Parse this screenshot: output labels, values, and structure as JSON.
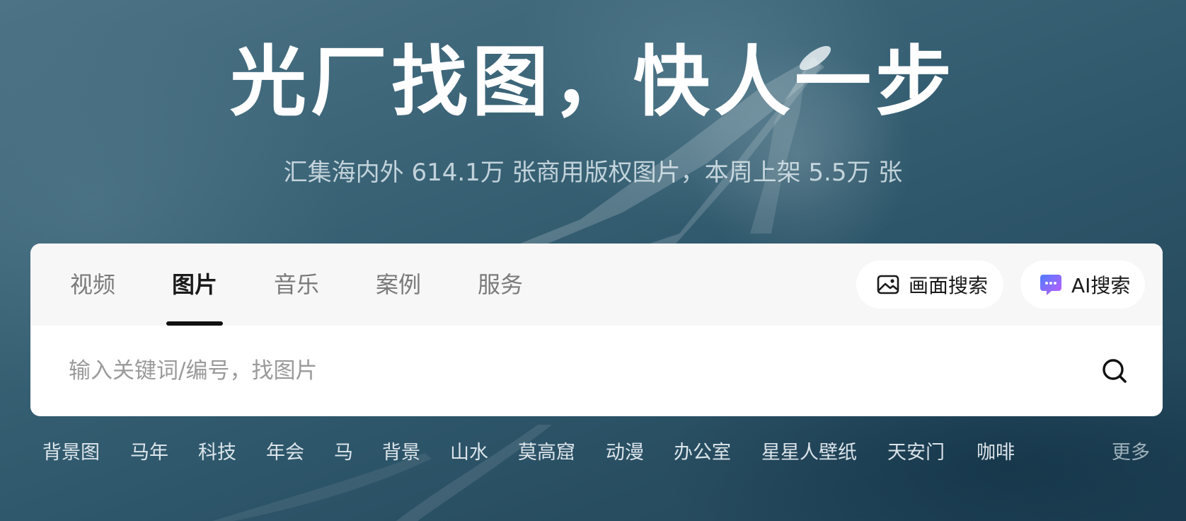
{
  "hero": {
    "title": "光厂找图，快人一步",
    "subtitle": "汇集海内外 614.1万 张商用版权图片，本周上架 5.5万 张"
  },
  "tabs": [
    {
      "label": "视频",
      "active": false
    },
    {
      "label": "图片",
      "active": true
    },
    {
      "label": "音乐",
      "active": false
    },
    {
      "label": "案例",
      "active": false
    },
    {
      "label": "服务",
      "active": false
    }
  ],
  "image_search": {
    "label": "画面搜索",
    "icon": "image-icon"
  },
  "ai_search": {
    "label": "AI搜索",
    "icon": "ai-chat-icon"
  },
  "search": {
    "placeholder": "输入关键词/编号，找图片",
    "value": "",
    "icon": "search-icon"
  },
  "hot_tags": [
    "背景图",
    "马年",
    "科技",
    "年会",
    "马",
    "背景",
    "山水",
    "莫高窟",
    "动漫",
    "办公室",
    "星星人壁纸",
    "天安门",
    "咖啡"
  ],
  "more_label": "更多",
  "colors": {
    "ocean": "#2f586c",
    "panel_bg": "#ffffff",
    "tabbar_bg": "#f7f7f7",
    "active_tab": "#1a1a1a",
    "inactive_tab": "#7a7a7a",
    "ai_gradient_start": "#4f7cff",
    "ai_gradient_end": "#c05cff"
  }
}
